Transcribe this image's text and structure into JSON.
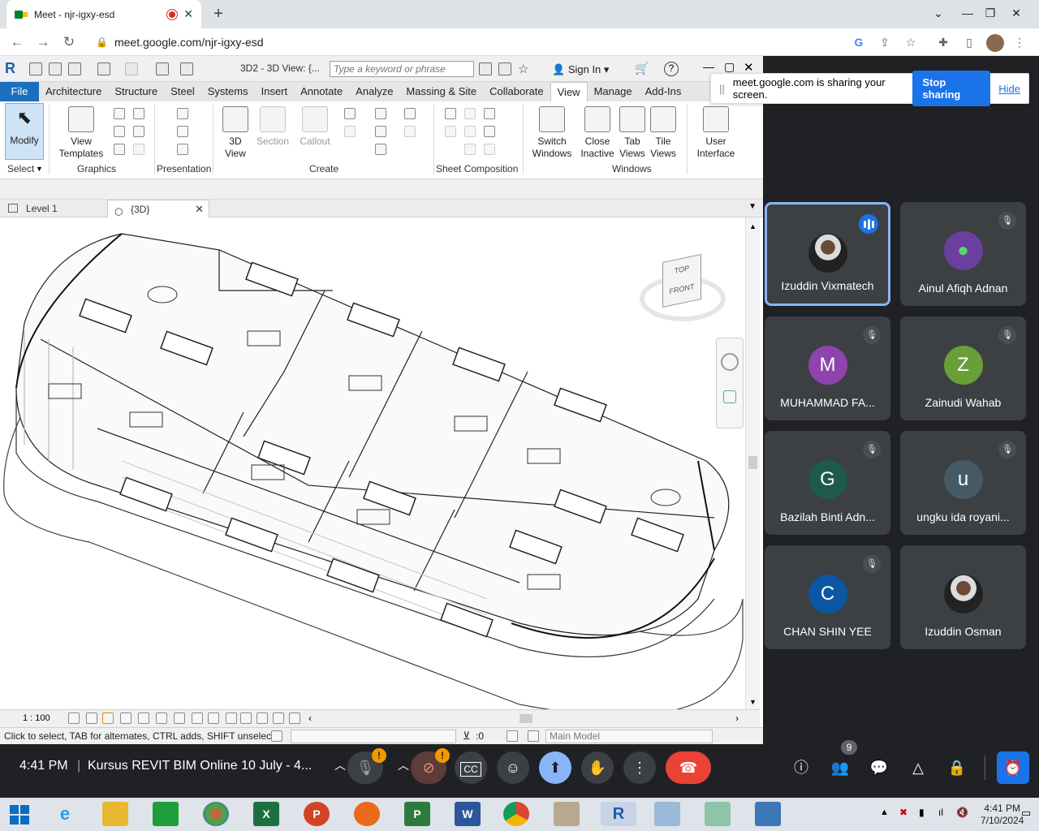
{
  "browser": {
    "tab_title": "Meet - njr-igxy-esd",
    "url": "meet.google.com/njr-igxy-esd"
  },
  "revit": {
    "doc_title": "3D2 - 3D View: {...",
    "search_placeholder": "Type a keyword or phrase",
    "sign_in": "Sign In",
    "ribbon_tabs": [
      "File",
      "Architecture",
      "Structure",
      "Steel",
      "Systems",
      "Insert",
      "Annotate",
      "Analyze",
      "Massing & Site",
      "Collaborate",
      "View",
      "Manage",
      "Add-Ins"
    ],
    "active_tab": "View",
    "buttons": {
      "modify": "Modify",
      "view_templates_1": "View",
      "view_templates_2": "Templates",
      "view3d_1": "3D",
      "view3d_2": "View",
      "section": "Section",
      "callout": "Callout",
      "switch_1": "Switch",
      "switch_2": "Windows",
      "close_1": "Close",
      "close_2": "Inactive",
      "tab_1": "Tab",
      "tab_2": "Views",
      "tile_1": "Tile",
      "tile_2": "Views",
      "ui_1": "User",
      "ui_2": "Interface"
    },
    "panels": {
      "select": "Select",
      "graphics": "Graphics",
      "presentation": "Presentation",
      "create": "Create",
      "sheet": "Sheet Composition",
      "windows": "Windows"
    },
    "view_tabs": {
      "level1": "Level 1",
      "threed": "{3D}"
    },
    "scale": "1 : 100",
    "status": "Click to select, TAB for alternates, CTRL adds, SHIFT unselects.",
    "filter_count": ":0",
    "model_dropdown": "Main Model",
    "viewcube_top": "TOP",
    "viewcube_front": "FRONT"
  },
  "share_banner": {
    "text": "meet.google.com is sharing your screen.",
    "stop": "Stop sharing",
    "hide": "Hide"
  },
  "participants": [
    {
      "name": "Izuddin Vixmatech",
      "initial": "",
      "color": "#5a5e63",
      "active": true
    },
    {
      "name": "Ainul Afiqh Adnan",
      "initial": "",
      "color": "#6b3fa0",
      "active": false
    },
    {
      "name": "MUHAMMAD FA...",
      "initial": "M",
      "color": "#8e44ad",
      "active": false
    },
    {
      "name": "Zainudi Wahab",
      "initial": "Z",
      "color": "#689f38",
      "active": false
    },
    {
      "name": "Bazilah Binti Adn...",
      "initial": "G",
      "color": "#1e5a4a",
      "active": false
    },
    {
      "name": "ungku ida royani...",
      "initial": "u",
      "color": "#455a64",
      "active": false
    },
    {
      "name": "CHAN SHIN YEE",
      "initial": "C",
      "color": "#0b57a4",
      "active": false
    },
    {
      "name": "Izuddin Osman",
      "initial": "",
      "color": "#5a5e63",
      "active": false
    }
  ],
  "meet": {
    "time": "4:41 PM",
    "meeting_title": "Kursus REVIT BIM Online 10 July - 4...",
    "participant_count": "9",
    "alert_badge": "!"
  },
  "taskbar": {
    "time": "4:41 PM",
    "date": "7/10/2024"
  },
  "colors": {
    "meet_blue": "#1a73e8",
    "end_call_red": "#ea4335",
    "revit_file_blue": "#1a6fbf"
  }
}
